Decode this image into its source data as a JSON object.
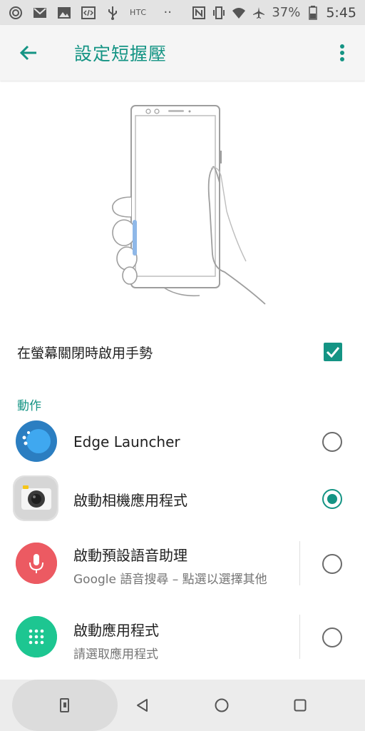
{
  "status_bar": {
    "carrier": "HTC",
    "dots": "··",
    "battery_percent": "37%",
    "time": "5:45",
    "icons": [
      "sync-icon",
      "gmail-icon",
      "image-icon",
      "code-icon",
      "usb-icon",
      "htc-icon",
      "nfc-icon",
      "vibrate-icon",
      "wifi-icon",
      "airplane-icon",
      "battery-icon"
    ]
  },
  "app_bar": {
    "title": "設定短握壓",
    "back_icon": "arrow-back-icon",
    "menu_icon": "more-vert-icon"
  },
  "setting": {
    "label": "在螢幕關閉時啟用手勢",
    "checked": true
  },
  "section": {
    "header": "動作"
  },
  "options": [
    {
      "title": "Edge Launcher",
      "subtitle": "",
      "selected": false,
      "icon": "edge-launcher-icon"
    },
    {
      "title": "啟動相機應用程式",
      "subtitle": "",
      "selected": true,
      "icon": "camera-icon"
    },
    {
      "title": "啟動預設語音助理",
      "subtitle": "Google 語音搜尋 – 點選以選擇其他",
      "selected": false,
      "icon": "microphone-icon"
    },
    {
      "title": "啟動應用程式",
      "subtitle": "請選取應用程式",
      "selected": false,
      "icon": "app-grid-icon"
    }
  ],
  "colors": {
    "accent": "#149484",
    "edge_icon": "#2b7ec1",
    "mic_icon": "#ec5a62",
    "apps_icon": "#1dc691"
  },
  "nav_bar": {
    "icons": [
      "recents-phone-icon",
      "back-triangle-icon",
      "home-circle-icon",
      "overview-square-icon"
    ]
  }
}
